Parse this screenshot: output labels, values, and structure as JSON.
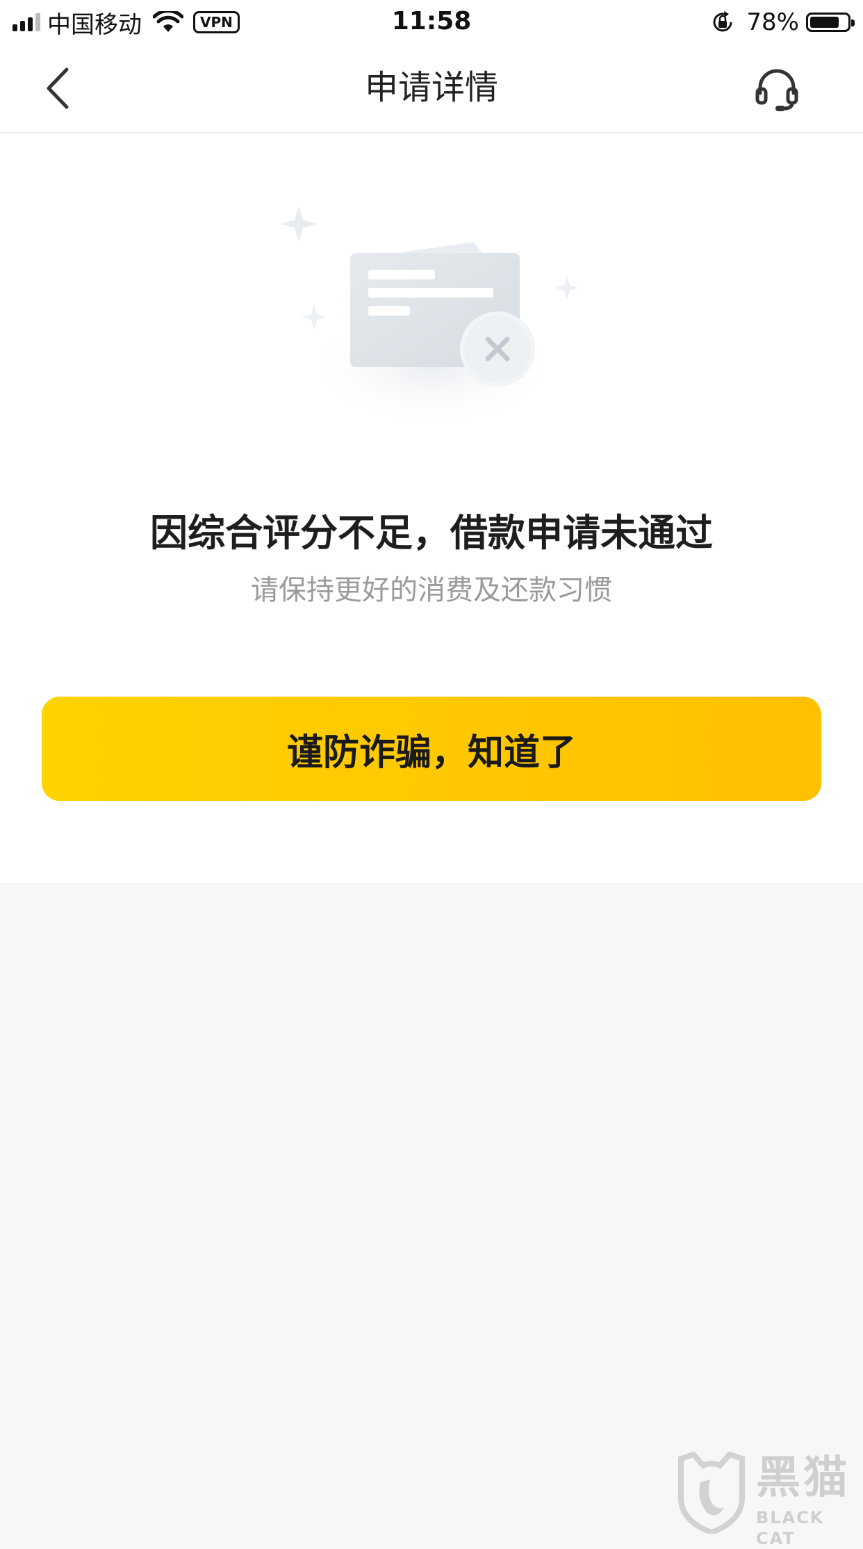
{
  "status_bar": {
    "carrier": "中国移动",
    "vpn": "VPN",
    "time": "11:58",
    "battery_percent": "78%",
    "battery_level": 0.78
  },
  "nav": {
    "title": "申请详情",
    "back_icon": "chevron-left-icon",
    "support_icon": "headset-icon"
  },
  "result": {
    "title": "因综合评分不足，借款申请未通过",
    "subtitle": "请保持更好的消费及还款习惯",
    "illustration_icon": "rejected-card-icon"
  },
  "actions": {
    "confirm_label": "谨防诈骗，知道了"
  },
  "watermark": {
    "cn": "黑猫",
    "en": "BLACK CAT"
  },
  "colors": {
    "accent": "#ffc800",
    "page_bg": "#f7f7f7",
    "subtitle": "#9a9a9a"
  }
}
